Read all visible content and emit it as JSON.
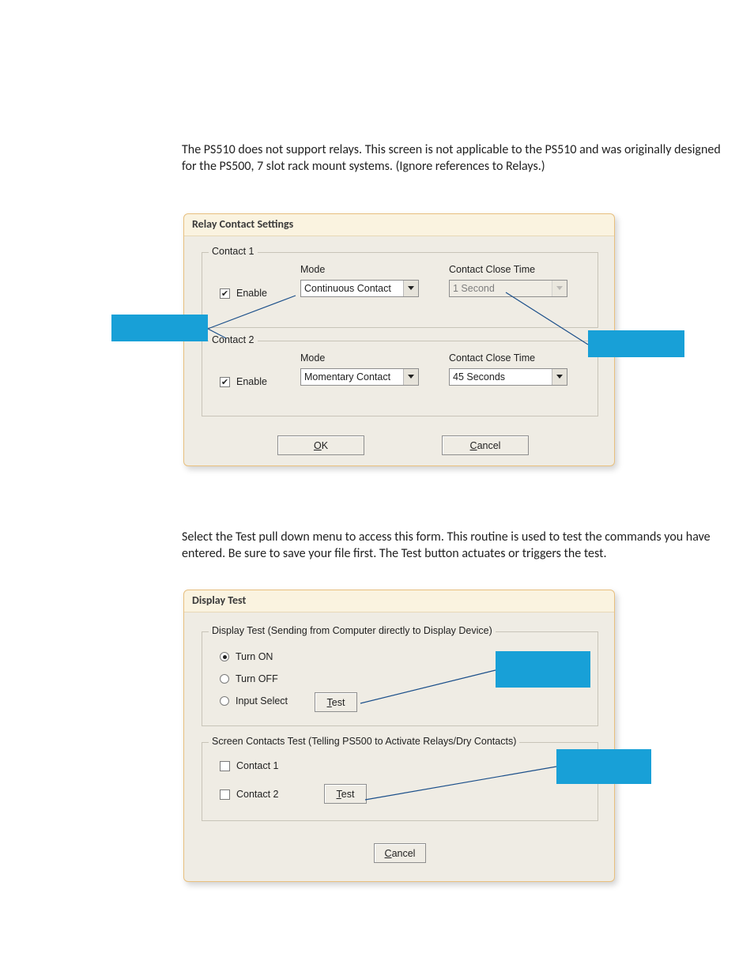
{
  "para1": "The PS510 does not support relays. This screen is not applicable to the PS510 and was originally designed for the PS500, 7 slot rack mount systems.  (Ignore references to Relays.)",
  "para2": "Select the Test pull down menu to access this form. This routine is used to test the commands you have entered. Be sure to save your file first. The Test button actuates or triggers the test.",
  "relay": {
    "title": "Relay Contact Settings",
    "c1": {
      "legend": "Contact 1",
      "enable_label": "Enable",
      "enable_checked": true,
      "mode_label": "Mode",
      "mode_value": "Continuous Contact",
      "time_label": "Contact Close Time",
      "time_value": "1 Second",
      "time_disabled": true
    },
    "c2": {
      "legend": "Contact 2",
      "enable_label": "Enable",
      "enable_checked": true,
      "mode_label": "Mode",
      "mode_value": "Momentary Contact",
      "time_label": "Contact Close Time",
      "time_value": "45 Seconds",
      "time_disabled": false
    },
    "ok_label": "OK",
    "cancel_label": "Cancel"
  },
  "test": {
    "title": "Display Test",
    "g1": {
      "legend": "Display Test (Sending from Computer directly to Display Device)",
      "opt_on": "Turn ON",
      "opt_off": "Turn OFF",
      "opt_input": "Input Select",
      "selected": "opt_on",
      "test_btn": "Test"
    },
    "g2": {
      "legend": "Screen Contacts Test (Telling PS500 to Activate Relays/Dry Contacts)",
      "chk1": "Contact 1",
      "chk1_checked": false,
      "chk2": "Contact 2",
      "chk2_checked": false,
      "test_btn": "Test"
    },
    "cancel_label": "Cancel"
  }
}
